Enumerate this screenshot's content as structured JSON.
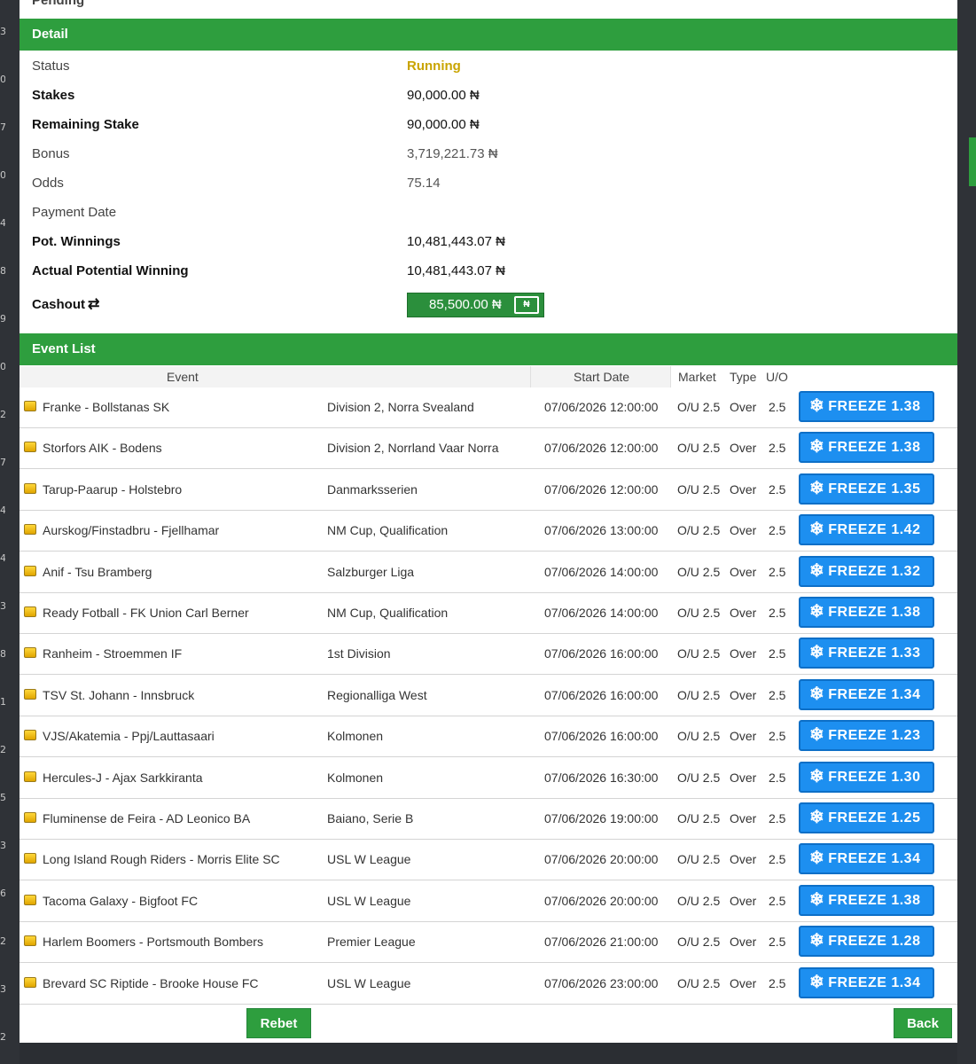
{
  "pending_label": "Pending",
  "detail": {
    "header": "Detail",
    "rows": [
      {
        "label": "Status",
        "value": "Running"
      },
      {
        "label": "Stakes",
        "value": "90,000.00 ₦"
      },
      {
        "label": "Remaining Stake",
        "value": "90,000.00 ₦"
      },
      {
        "label": "Bonus",
        "value": "3,719,221.73 ₦"
      },
      {
        "label": "Odds",
        "value": "75.14"
      },
      {
        "label": "Payment Date",
        "value": ""
      },
      {
        "label": "Pot. Winnings",
        "value": "10,481,443.07 ₦"
      },
      {
        "label": "Actual Potential Winning",
        "value": "10,481,443.07 ₦"
      }
    ],
    "cashout_label": "Cashout",
    "cashout_icon": "refresh-icon",
    "cashout_value": "85,500.00 ₦",
    "cashout_money_icon": "₦"
  },
  "events": {
    "header": "Event List",
    "columns": {
      "event": "Event",
      "start_date": "Start Date",
      "market": "Market",
      "type": "Type",
      "uo": "U/O"
    },
    "rows": [
      {
        "event": "Franke - Bollstanas SK",
        "league": "Division 2, Norra Svealand",
        "date": "07/06/2026 12:00:00",
        "market": "O/U 2.5",
        "type": "Over",
        "uo": "2.5",
        "freeze": "FREEZE 1.38"
      },
      {
        "event": "Storfors AIK - Bodens",
        "league": "Division 2, Norrland Vaar Norra",
        "date": "07/06/2026 12:00:00",
        "market": "O/U 2.5",
        "type": "Over",
        "uo": "2.5",
        "freeze": "FREEZE 1.38"
      },
      {
        "event": "Tarup-Paarup - Holstebro",
        "league": "Danmarksserien",
        "date": "07/06/2026 12:00:00",
        "market": "O/U 2.5",
        "type": "Over",
        "uo": "2.5",
        "freeze": "FREEZE 1.35"
      },
      {
        "event": "Aurskog/Finstadbru - Fjellhamar",
        "league": "NM Cup, Qualification",
        "date": "07/06/2026 13:00:00",
        "market": "O/U 2.5",
        "type": "Over",
        "uo": "2.5",
        "freeze": "FREEZE 1.42"
      },
      {
        "event": "Anif - Tsu Bramberg",
        "league": "Salzburger Liga",
        "date": "07/06/2026 14:00:00",
        "market": "O/U 2.5",
        "type": "Over",
        "uo": "2.5",
        "freeze": "FREEZE 1.32"
      },
      {
        "event": "Ready Fotball - FK Union Carl Berner",
        "league": "NM Cup, Qualification",
        "date": "07/06/2026 14:00:00",
        "market": "O/U 2.5",
        "type": "Over",
        "uo": "2.5",
        "freeze": "FREEZE 1.38"
      },
      {
        "event": "Ranheim - Stroemmen IF",
        "league": "1st Division",
        "date": "07/06/2026 16:00:00",
        "market": "O/U 2.5",
        "type": "Over",
        "uo": "2.5",
        "freeze": "FREEZE 1.33"
      },
      {
        "event": "TSV St. Johann - Innsbruck",
        "league": "Regionalliga West",
        "date": "07/06/2026 16:00:00",
        "market": "O/U 2.5",
        "type": "Over",
        "uo": "2.5",
        "freeze": "FREEZE 1.34"
      },
      {
        "event": "VJS/Akatemia - Ppj/Lauttasaari",
        "league": "Kolmonen",
        "date": "07/06/2026 16:00:00",
        "market": "O/U 2.5",
        "type": "Over",
        "uo": "2.5",
        "freeze": "FREEZE 1.23"
      },
      {
        "event": "Hercules-J - Ajax Sarkkiranta",
        "league": "Kolmonen",
        "date": "07/06/2026 16:30:00",
        "market": "O/U 2.5",
        "type": "Over",
        "uo": "2.5",
        "freeze": "FREEZE 1.30"
      },
      {
        "event": "Fluminense de Feira - AD Leonico BA",
        "league": "Baiano, Serie B",
        "date": "07/06/2026 19:00:00",
        "market": "O/U 2.5",
        "type": "Over",
        "uo": "2.5",
        "freeze": "FREEZE 1.25"
      },
      {
        "event": "Long Island Rough Riders - Morris Elite SC",
        "league": "USL W League",
        "date": "07/06/2026 20:00:00",
        "market": "O/U 2.5",
        "type": "Over",
        "uo": "2.5",
        "freeze": "FREEZE 1.34"
      },
      {
        "event": "Tacoma Galaxy - Bigfoot FC",
        "league": "USL W League",
        "date": "07/06/2026 20:00:00",
        "market": "O/U 2.5",
        "type": "Over",
        "uo": "2.5",
        "freeze": "FREEZE 1.38"
      },
      {
        "event": "Harlem Boomers - Portsmouth Bombers",
        "league": "Premier League",
        "date": "07/06/2026 21:00:00",
        "market": "O/U 2.5",
        "type": "Over",
        "uo": "2.5",
        "freeze": "FREEZE 1.28"
      },
      {
        "event": "Brevard SC Riptide - Brooke House FC",
        "league": "USL W League",
        "date": "07/06/2026 23:00:00",
        "market": "O/U 2.5",
        "type": "Over",
        "uo": "2.5",
        "freeze": "FREEZE 1.34"
      }
    ]
  },
  "footer": {
    "rebet_label": "Rebet",
    "back_label": "Back"
  },
  "gutter_numbers": [
    "3",
    "0",
    "7",
    "0",
    "4",
    "8",
    "9",
    "0",
    "2",
    "7",
    "4",
    "4",
    "3",
    "8",
    "1",
    "2",
    "5",
    "3",
    "6",
    "2",
    "3",
    "2"
  ],
  "colors": {
    "accent_green": "#2e9e3e",
    "freeze_blue": "#1d8ff0",
    "running": "#c9a400"
  }
}
